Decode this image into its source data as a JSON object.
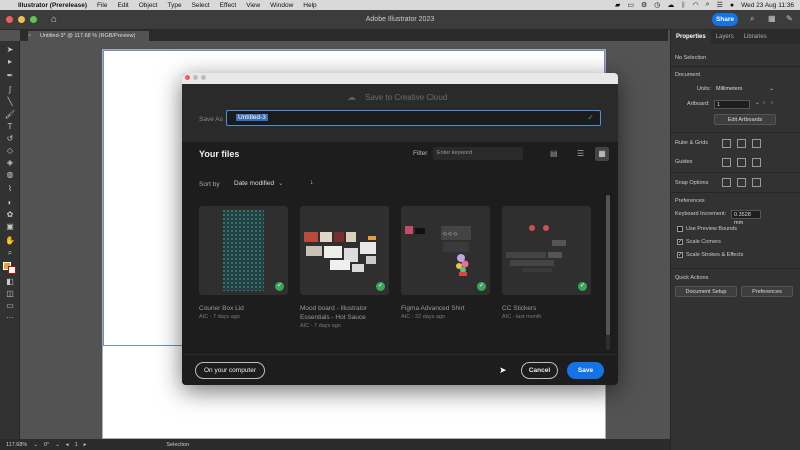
{
  "menubar": {
    "app_name": "Illustrator (Prerelease)",
    "items": [
      "File",
      "Edit",
      "Object",
      "Type",
      "Select",
      "Effect",
      "View",
      "Window",
      "Help"
    ],
    "datetime": "Wed 23 Aug  11:36"
  },
  "appbar": {
    "title": "Adobe Illustrator 2023",
    "share_label": "Share"
  },
  "document": {
    "tab_title": "Untitled-3* @ 117.68 % (RGB/Preview)",
    "zoom": "117.68%",
    "rotation": "0°",
    "artboard_num": "1",
    "status_tool": "Selection"
  },
  "properties_panel": {
    "tabs": [
      "Properties",
      "Layers",
      "Libraries"
    ],
    "active_tab": "Properties",
    "selection": "No Selection",
    "document_heading": "Document",
    "units_label": "Units:",
    "units_value": "Millimeters",
    "artboard_label": "Artboard:",
    "artboard_value": "1",
    "edit_artboards_label": "Edit Artboards",
    "rulers_grids_label": "Ruler & Grids",
    "guides_label": "Guides",
    "snap_options_label": "Snap Options",
    "preferences_heading": "Preferences",
    "keyboard_increment_label": "Keyboard Increment:",
    "keyboard_increment_value": "0.3528 mm",
    "checkboxes": [
      {
        "label": "Use Preview Bounds",
        "checked": false
      },
      {
        "label": "Scale Corners",
        "checked": true
      },
      {
        "label": "Scale Strokes & Effects",
        "checked": true
      }
    ],
    "quick_actions_heading": "Quick Actions",
    "document_setup_label": "Document Setup",
    "preferences_label": "Preferences"
  },
  "dialog": {
    "title": "Save to Creative Cloud",
    "save_as_label": "Save As",
    "save_as_value": "Untitled-3",
    "your_files_heading": "Your files",
    "filter_label": "Filter",
    "filter_placeholder": "Enter keyword",
    "sort_by_label": "Sort by",
    "sort_value": "Date modified",
    "files": [
      {
        "name": "Courier Box Lid",
        "meta": "AIC - 7 days ago"
      },
      {
        "name": "Mood board - Illustrator Essentials - Hot Sauce",
        "meta": "AIC - 7 days ago"
      },
      {
        "name": "Figma Advanced Shirt",
        "meta": "AIC - 22 days ago"
      },
      {
        "name": "CC Stickers",
        "meta": "AIC - last month"
      }
    ],
    "on_computer_label": "On your computer",
    "cancel_label": "Cancel",
    "save_label": "Save"
  },
  "colors": {
    "accent": "#1473e6",
    "dialog_bg": "#1d1d1d",
    "sync_green": "#3ba55c"
  }
}
